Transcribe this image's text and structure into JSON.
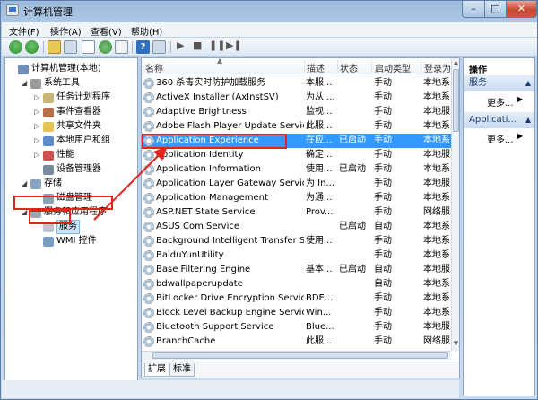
{
  "window": {
    "title": "计算机管理"
  },
  "menu": [
    "文件(F)",
    "操作(A)",
    "查看(V)",
    "帮助(H)"
  ],
  "tree": [
    {
      "label": "计算机管理(本地)",
      "icon": "computer-icon",
      "level": 0,
      "expander": ""
    },
    {
      "label": "系统工具",
      "icon": "tools-icon",
      "level": 1,
      "expander": "◢"
    },
    {
      "label": "任务计划程序",
      "icon": "clock-icon",
      "level": 2,
      "expander": "▷"
    },
    {
      "label": "事件查看器",
      "icon": "event-icon",
      "level": 2,
      "expander": "▷"
    },
    {
      "label": "共享文件夹",
      "icon": "folder-icon",
      "level": 2,
      "expander": "▷"
    },
    {
      "label": "本地用户和组",
      "icon": "users-icon",
      "level": 2,
      "expander": "▷"
    },
    {
      "label": "性能",
      "icon": "performance-icon",
      "level": 2,
      "expander": "▷"
    },
    {
      "label": "设备管理器",
      "icon": "device-icon",
      "level": 2,
      "expander": ""
    },
    {
      "label": "存储",
      "icon": "storage-icon",
      "level": 1,
      "expander": "◢"
    },
    {
      "label": "磁盘管理",
      "icon": "disk-icon",
      "level": 2,
      "expander": ""
    },
    {
      "label": "服务和应用程序",
      "icon": "services-apps-icon",
      "level": 1,
      "expander": "◢"
    },
    {
      "label": "服务",
      "icon": "gear-icon",
      "level": 2,
      "expander": "",
      "selected": true
    },
    {
      "label": "WMI 控件",
      "icon": "wmi-icon",
      "level": 2,
      "expander": ""
    }
  ],
  "columns": {
    "name": "名称",
    "desc": "描述",
    "state": "状态",
    "start": "启动类型",
    "logon": "登录为"
  },
  "services": [
    {
      "name": "360 杀毒实时防护加载服务",
      "desc": "本服...",
      "state": "",
      "start": "手动",
      "logon": "本地系"
    },
    {
      "name": "ActiveX Installer (AxInstSV)",
      "desc": "为从 ...",
      "state": "",
      "start": "手动",
      "logon": "本地系"
    },
    {
      "name": "Adaptive Brightness",
      "desc": "监视...",
      "state": "",
      "start": "手动",
      "logon": "本地服"
    },
    {
      "name": "Adobe Flash Player Update Service",
      "desc": "此服...",
      "state": "",
      "start": "手动",
      "logon": "本地系"
    },
    {
      "name": "Application Experience",
      "desc": "在应...",
      "state": "已启动",
      "start": "手动",
      "logon": "本地系",
      "selected": true
    },
    {
      "name": "Application Identity",
      "desc": "确定...",
      "state": "",
      "start": "手动",
      "logon": "本地服"
    },
    {
      "name": "Application Information",
      "desc": "使用...",
      "state": "已启动",
      "start": "手动",
      "logon": "本地系"
    },
    {
      "name": "Application Layer Gateway Service",
      "desc": "为 In...",
      "state": "",
      "start": "手动",
      "logon": "本地服"
    },
    {
      "name": "Application Management",
      "desc": "为通...",
      "state": "",
      "start": "手动",
      "logon": "本地系"
    },
    {
      "name": "ASP.NET State Service",
      "desc": "Prov...",
      "state": "",
      "start": "手动",
      "logon": "网络服"
    },
    {
      "name": "ASUS Com Service",
      "desc": "",
      "state": "已启动",
      "start": "自动",
      "logon": "本地系"
    },
    {
      "name": "Background Intelligent Transfer S...",
      "desc": "使用...",
      "state": "",
      "start": "手动",
      "logon": "本地系"
    },
    {
      "name": "BaiduYunUtility",
      "desc": "",
      "state": "",
      "start": "手动",
      "logon": "本地系"
    },
    {
      "name": "Base Filtering Engine",
      "desc": "基本...",
      "state": "已启动",
      "start": "自动",
      "logon": "本地服"
    },
    {
      "name": "bdwallpaperupdate",
      "desc": "",
      "state": "",
      "start": "自动",
      "logon": "本地系"
    },
    {
      "name": "BitLocker Drive Encryption Service",
      "desc": "BDE...",
      "state": "",
      "start": "手动",
      "logon": "本地系"
    },
    {
      "name": "Block Level Backup Engine Service",
      "desc": "Win...",
      "state": "",
      "start": "手动",
      "logon": "本地系"
    },
    {
      "name": "Bluetooth Support Service",
      "desc": "Blue...",
      "state": "",
      "start": "手动",
      "logon": "本地服"
    },
    {
      "name": "BranchCache",
      "desc": "此服...",
      "state": "",
      "start": "手动",
      "logon": "网络服"
    }
  ],
  "tabs": [
    "扩展",
    "标准"
  ],
  "actions": {
    "title": "操作",
    "groups": [
      {
        "label": "服务",
        "more": "更多..."
      },
      {
        "label": "Applicati...",
        "more": "更多..."
      }
    ]
  },
  "colors": {
    "selection": "#3399ff",
    "annotation": "#e2231a"
  }
}
